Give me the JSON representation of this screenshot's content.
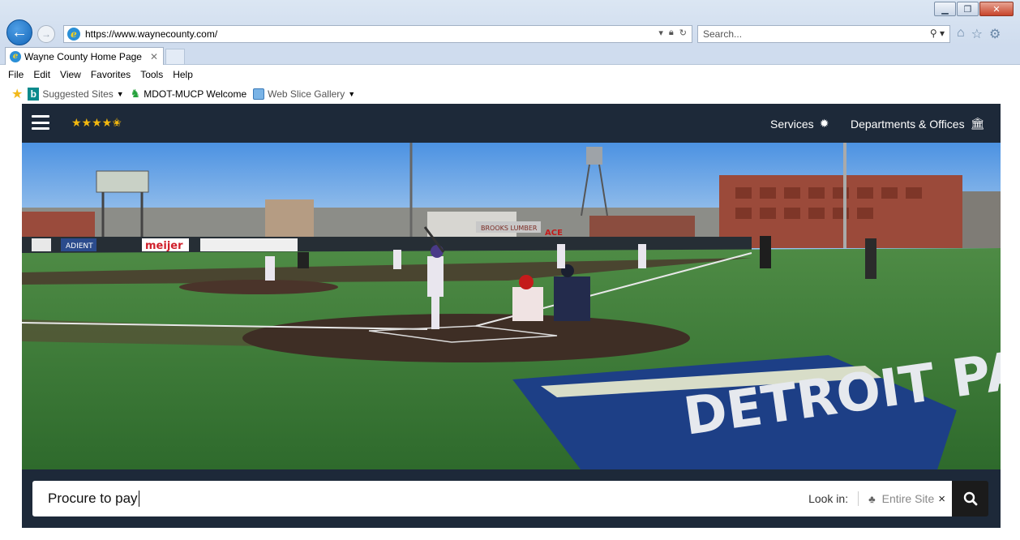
{
  "browser": {
    "url": "https://www.waynecounty.com/",
    "search_placeholder": "Search...",
    "tab_title": "Wayne County Home Page",
    "menu": [
      "File",
      "Edit",
      "View",
      "Favorites",
      "Tools",
      "Help"
    ],
    "favorites": [
      {
        "label": "Suggested Sites",
        "icon": "bing-icon",
        "dropdown": true
      },
      {
        "label": "MDOT-MUCP Welcome",
        "icon": "mdot-icon",
        "dropdown": false
      },
      {
        "label": "Web Slice Gallery",
        "icon": "web-slice-icon",
        "dropdown": true
      }
    ]
  },
  "site": {
    "rating_stars": "★★★★✬",
    "nav_services": "Services",
    "nav_departments": "Departments & Offices",
    "hero_signs": {
      "sponsor1": "ADIENT",
      "sponsor2": "meijer",
      "building_sign": "BROOKS LUMBER",
      "ace": "ACE",
      "field_logo": "DETROIT PAL"
    },
    "search": {
      "value": "Procure to pay",
      "look_in_label": "Look in:",
      "scope": "Entire Site",
      "clear": "×"
    }
  },
  "colors": {
    "nav_bg": "#1d2939",
    "star": "#f2b80f",
    "search_button": "#1b1b1b"
  }
}
